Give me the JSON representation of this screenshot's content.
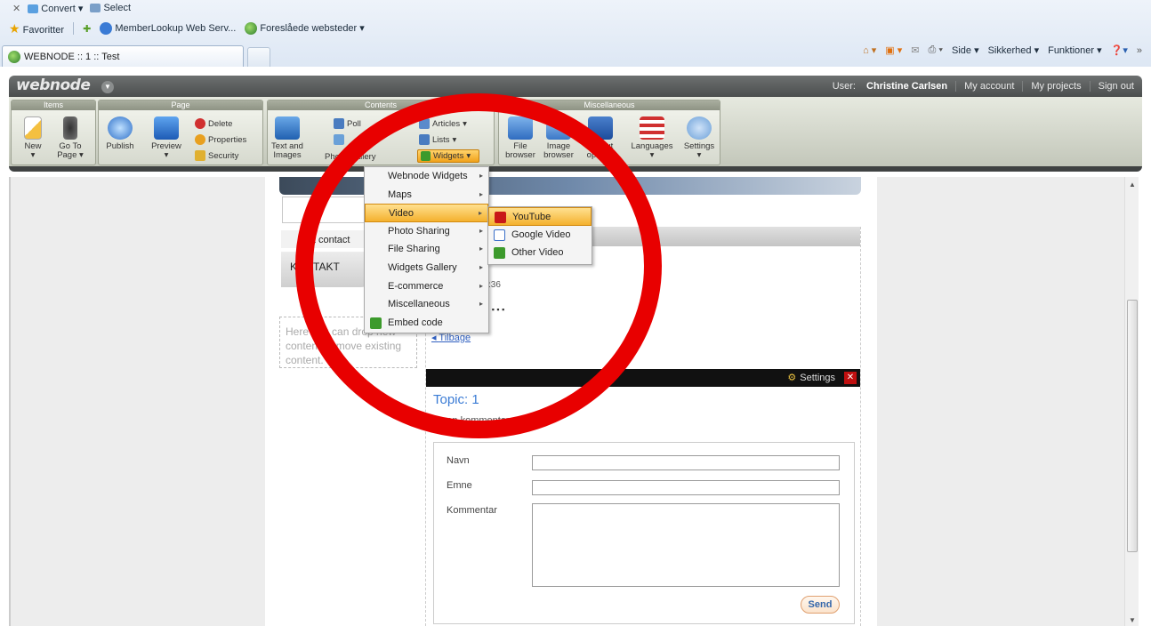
{
  "browser": {
    "row1": {
      "convert": "Convert",
      "select": "Select"
    },
    "favorites": {
      "label": "Favoritter",
      "link1": "MemberLookup Web Serv...",
      "link2": "Foreslåede websteder"
    },
    "tab_title": "WEBNODE :: 1 :: Test",
    "commands": {
      "page": "Side",
      "safety": "Sikkerhed",
      "tools": "Funktioner"
    }
  },
  "webnode": {
    "logo": "webnode",
    "user_prefix": "User:",
    "user_name": "Christine Carlsen",
    "my_account": "My account",
    "my_projects": "My projects",
    "sign_out": "Sign out"
  },
  "ribbon": {
    "groups": {
      "items": "Items",
      "page": "Page",
      "contents": "Contents",
      "misc": "Miscellaneous"
    },
    "items": {
      "new": "New",
      "goto": "Go To Page"
    },
    "page": {
      "publish": "Publish",
      "preview": "Preview",
      "delete": "Delete",
      "properties": "Properties",
      "security": "Security"
    },
    "contents": {
      "text_images": "Text and Images",
      "poll": "Poll",
      "photo_gallery": "Photo Gallery",
      "articles": "Articles",
      "lists": "Lists",
      "widgets": "Widgets"
    },
    "misc": {
      "file_browser": "File browser",
      "image_browser": "Image browser",
      "layout": "Layout options",
      "languages": "Languages",
      "settings": "Settings"
    }
  },
  "widgets_menu": [
    {
      "label": "Webnode Widgets"
    },
    {
      "label": "Maps"
    },
    {
      "label": "Video"
    },
    {
      "label": "Photo Sharing"
    },
    {
      "label": "File Sharing"
    },
    {
      "label": "Widgets Gallery"
    },
    {
      "label": "E-commerce"
    },
    {
      "label": "Miscellaneous"
    },
    {
      "label": "Embed code"
    }
  ],
  "video_submenu": [
    {
      "label": "YouTube"
    },
    {
      "label": "Google Video"
    },
    {
      "label": "Other Video"
    }
  ],
  "page": {
    "edit_contact": "Edit contact",
    "kontakt": "KONTAKT",
    "dashed_hint": "Here you can drop new content or move existing content.",
    "time_fragment": ":36",
    "back_link": "Tilbage",
    "settings": "Settings",
    "topic": "Topic: 1",
    "no_comments": "Ingen kommentarer",
    "form": {
      "name": "Navn",
      "subject": "Emne",
      "comment": "Kommentar",
      "send": "Send"
    }
  },
  "colors": {
    "annotation": "#e80000",
    "highlight": "#f4b12e",
    "topic": "#3a7bd5"
  }
}
